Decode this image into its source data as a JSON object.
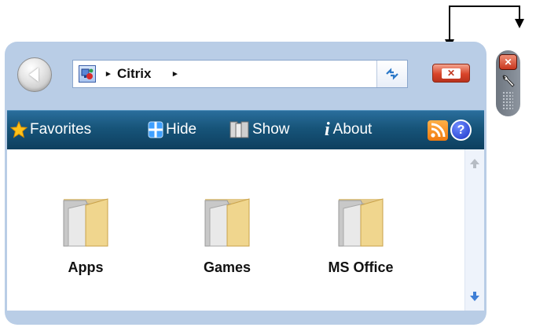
{
  "nav": {
    "back_icon": "back-arrow-icon",
    "address": {
      "icon": "computer-icon",
      "separator": "▸",
      "path": [
        "Citrix"
      ],
      "refresh_icon": "refresh-icon"
    },
    "close_label": "✕"
  },
  "toolbar": {
    "favorites": {
      "label": "Favorites",
      "icon": "star-icon"
    },
    "hide": {
      "label": "Hide",
      "icon": "hide-icon"
    },
    "show": {
      "label": "Show",
      "icon": "show-icon"
    },
    "about": {
      "label": "About",
      "icon": "info-icon",
      "glyph": "i"
    },
    "rss_icon": "rss-icon",
    "help": {
      "icon": "help-icon",
      "glyph": "?"
    }
  },
  "folders": [
    {
      "label": "Apps",
      "icon": "folder-icon"
    },
    {
      "label": "Games",
      "icon": "folder-icon"
    },
    {
      "label": "MS Office",
      "icon": "folder-icon"
    }
  ],
  "side_controls": {
    "close_label": "✕",
    "options_icon": "wrench-icon",
    "drag_icon": "drag-handle-icon"
  },
  "colors": {
    "frame": "#b9cde6",
    "toolbar": "#175479",
    "close": "#d9452a",
    "content": "#ffffff"
  }
}
